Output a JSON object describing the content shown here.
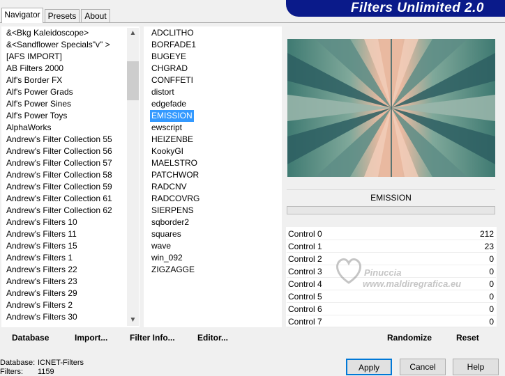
{
  "tabs": [
    "Navigator",
    "Presets",
    "About"
  ],
  "banner_title": "Filters Unlimited 2.0",
  "categories": [
    "&<Bkg Kaleidoscope>",
    "&<Sandflower Specials\"v\" >",
    "[AFS IMPORT]",
    "AB Filters 2000",
    "Alf's Border FX",
    "Alf's Power Grads",
    "Alf's Power Sines",
    "Alf's Power Toys",
    "AlphaWorks",
    "Andrew's Filter Collection 55",
    "Andrew's Filter Collection 56",
    "Andrew's Filter Collection 57",
    "Andrew's Filter Collection 58",
    "Andrew's Filter Collection 59",
    "Andrew's Filter Collection 61",
    "Andrew's Filter Collection 62",
    "Andrew's Filters 10",
    "Andrew's Filters 11",
    "Andrew's Filters 15",
    "Andrew's Filters 1",
    "Andrew's Filters 22",
    "Andrew's Filters 23",
    "Andrew's Filters 29",
    "Andrew's Filters 2",
    "Andrew's Filters 30"
  ],
  "filters": [
    "ADCLITHO",
    "BORFADE1",
    "BUGEYE",
    "CHGRAD",
    "CONFFETI",
    "distort",
    "edgefade",
    "EMISSION",
    "ewscript",
    "HEIZENBE",
    "KookyGI",
    "MAELSTRO",
    "PATCHWOR",
    "RADCNV",
    "RADCOVRG",
    "SIERPENS",
    "sqborder2",
    "squares",
    "wave",
    "win_092",
    "ZIGZAGGE"
  ],
  "selected_filter": "EMISSION",
  "filter_name": "EMISSION",
  "controls": [
    {
      "label": "Control 0",
      "value": "212"
    },
    {
      "label": "Control 1",
      "value": "23"
    },
    {
      "label": "Control 2",
      "value": "0"
    },
    {
      "label": "Control 3",
      "value": "0"
    },
    {
      "label": "Control 4",
      "value": "0"
    },
    {
      "label": "Control 5",
      "value": "0"
    },
    {
      "label": "Control 6",
      "value": "0"
    },
    {
      "label": "Control 7",
      "value": "0"
    }
  ],
  "left_buttons": {
    "database": "Database",
    "import": "Import...",
    "filter_info": "Filter Info...",
    "editor": "Editor..."
  },
  "right_buttons": {
    "randomize": "Randomize",
    "reset": "Reset"
  },
  "status": {
    "db_label": "Database:",
    "db_value": "ICNET-Filters",
    "filters_label": "Filters:",
    "filters_value": "1159"
  },
  "dialog_buttons": {
    "apply": "Apply",
    "cancel": "Cancel",
    "help": "Help"
  },
  "watermark": {
    "line1": "Pinuccia",
    "line2": "www.maldiregrafica.eu"
  },
  "colors": {
    "selection": "#3399ff",
    "banner": "#0a1a8a",
    "preview_teal": "#3f7a72",
    "preview_peach": "#e9b9a0"
  }
}
